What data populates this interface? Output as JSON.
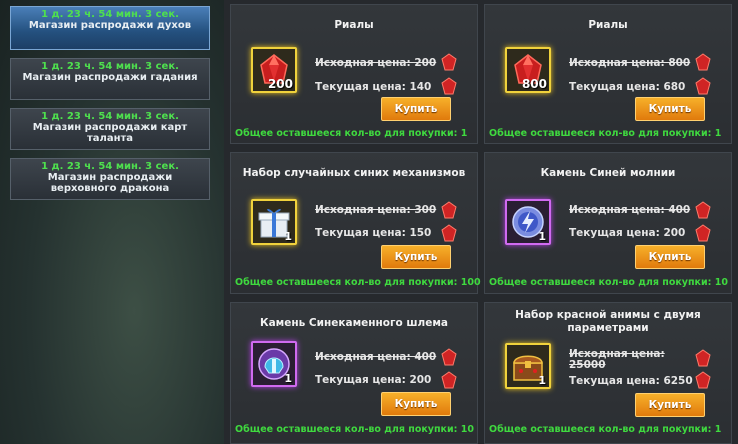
{
  "tabs": [
    {
      "timer": "1 д. 23 ч. 54 мин. 3 сек.",
      "name": "Магазин распродажи духов",
      "active": true
    },
    {
      "timer": "1 д. 23 ч. 54 мин. 3 сек.",
      "name": "Магазин распродажи гадания",
      "active": false
    },
    {
      "timer": "1 д. 23 ч. 54 мин. 3 сек.",
      "name": "Магазин распродажи карт таланта",
      "active": false
    },
    {
      "timer": "1 д. 23 ч. 54 мин. 3 сек.",
      "name": "Магазин распродажи верховного дракона",
      "active": false
    }
  ],
  "items": [
    {
      "title": "Риалы",
      "icon": "red-gem-icon",
      "qty": "200",
      "orig_label": "Исходная цена: 200",
      "cur_label": "Текущая цена: 140",
      "buy": "Купить",
      "remain": "Общее оставшееся кол-во для покупки: 1"
    },
    {
      "title": "Риалы",
      "icon": "red-gem-icon",
      "qty": "800",
      "orig_label": "Исходная цена: 800",
      "cur_label": "Текущая цена: 680",
      "buy": "Купить",
      "remain": "Общее оставшееся кол-во для покупки: 1"
    },
    {
      "title": "Набор случайных синих механизмов",
      "icon": "gift-box-icon",
      "qty": "1",
      "orig_label": "Исходная цена: 300",
      "cur_label": "Текущая цена: 150",
      "buy": "Купить",
      "remain": "Общее оставшееся кол-во для покупки: 100"
    },
    {
      "title": "Камень Синей молнии",
      "icon": "blue-lightning-stone-icon",
      "qty": "1",
      "orig_label": "Исходная цена: 400",
      "cur_label": "Текущая цена: 200",
      "buy": "Купить",
      "remain": "Общее оставшееся кол-во для покупки: 10"
    },
    {
      "title": "Камень Синекаменного шлема",
      "icon": "blue-helmet-stone-icon",
      "qty": "1",
      "orig_label": "Исходная цена: 400",
      "cur_label": "Текущая цена: 200",
      "buy": "Купить",
      "remain": "Общее оставшееся кол-во для покупки: 10"
    },
    {
      "title": "Набор красной анимы с двумя параметрами",
      "icon": "treasure-chest-icon",
      "qty": "1",
      "orig_label": "Исходная цена: 25000",
      "cur_label": "Текущая цена: 6250",
      "buy": "Купить",
      "remain": "Общее оставшееся кол-во для покупки: 1"
    }
  ],
  "colors": {
    "accent_green": "#3fd93f",
    "button_orange": "#f0961c",
    "active_tab": "#3a6ea5"
  }
}
